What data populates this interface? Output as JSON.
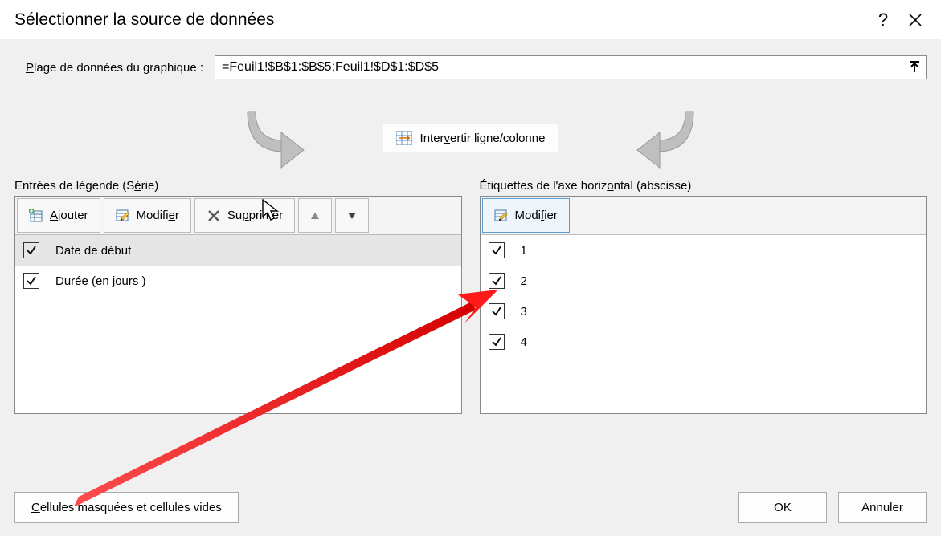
{
  "title": "Sélectionner la source de données",
  "help_char": "?",
  "range_label_pre": "P",
  "range_label_rest": "lage de données du graphique :",
  "range_value": "=Feuil1!$B$1:$B$5;Feuil1!$D$1:$D$5",
  "swap_label_pre": "Inter",
  "swap_label_u": "v",
  "swap_label_rest": "ertir ligne/colonne",
  "legend": {
    "header_pre": "Entrées de légende (S",
    "header_u": "é",
    "header_rest": "rie)",
    "add_u": "A",
    "add_rest": "jouter",
    "edit_pre": "Modifi",
    "edit_u": "e",
    "edit_rest": "r",
    "delete_pre": "Su",
    "delete_u": "p",
    "delete_rest": "primer",
    "items": [
      {
        "label": "Date de début",
        "checked": true,
        "selected": true
      },
      {
        "label": "Durée  (en jours )",
        "checked": true,
        "selected": false
      }
    ]
  },
  "axis": {
    "header_pre": "Étiquettes de l'axe horiz",
    "header_u": "o",
    "header_rest": "ntal (abscisse)",
    "edit_pre": "Modi",
    "edit_u": "f",
    "edit_rest": "ier",
    "items": [
      {
        "label": "1",
        "checked": true
      },
      {
        "label": "2",
        "checked": true
      },
      {
        "label": "3",
        "checked": true
      },
      {
        "label": "4",
        "checked": true
      }
    ]
  },
  "footer": {
    "hidden_u": "C",
    "hidden_rest": "ellules masquées et cellules vides",
    "ok": "OK",
    "cancel": "Annuler"
  }
}
